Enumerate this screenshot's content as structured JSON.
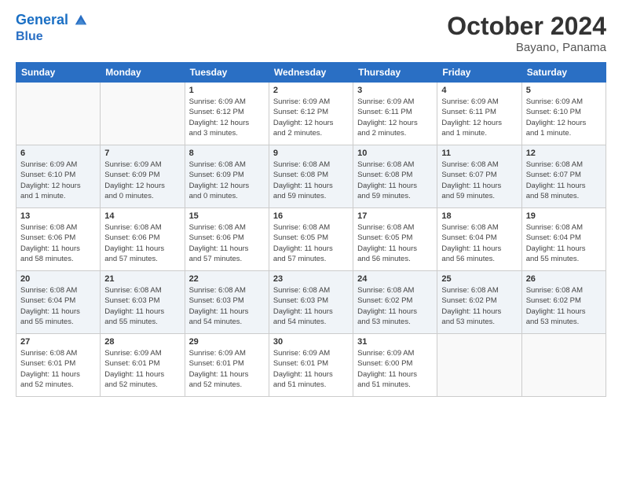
{
  "header": {
    "logo_line1": "General",
    "logo_line2": "Blue",
    "month": "October 2024",
    "location": "Bayano, Panama"
  },
  "weekdays": [
    "Sunday",
    "Monday",
    "Tuesday",
    "Wednesday",
    "Thursday",
    "Friday",
    "Saturday"
  ],
  "weeks": [
    [
      {
        "day": "",
        "detail": ""
      },
      {
        "day": "",
        "detail": ""
      },
      {
        "day": "1",
        "detail": "Sunrise: 6:09 AM\nSunset: 6:12 PM\nDaylight: 12 hours\nand 3 minutes."
      },
      {
        "day": "2",
        "detail": "Sunrise: 6:09 AM\nSunset: 6:12 PM\nDaylight: 12 hours\nand 2 minutes."
      },
      {
        "day": "3",
        "detail": "Sunrise: 6:09 AM\nSunset: 6:11 PM\nDaylight: 12 hours\nand 2 minutes."
      },
      {
        "day": "4",
        "detail": "Sunrise: 6:09 AM\nSunset: 6:11 PM\nDaylight: 12 hours\nand 1 minute."
      },
      {
        "day": "5",
        "detail": "Sunrise: 6:09 AM\nSunset: 6:10 PM\nDaylight: 12 hours\nand 1 minute."
      }
    ],
    [
      {
        "day": "6",
        "detail": "Sunrise: 6:09 AM\nSunset: 6:10 PM\nDaylight: 12 hours\nand 1 minute."
      },
      {
        "day": "7",
        "detail": "Sunrise: 6:09 AM\nSunset: 6:09 PM\nDaylight: 12 hours\nand 0 minutes."
      },
      {
        "day": "8",
        "detail": "Sunrise: 6:08 AM\nSunset: 6:09 PM\nDaylight: 12 hours\nand 0 minutes."
      },
      {
        "day": "9",
        "detail": "Sunrise: 6:08 AM\nSunset: 6:08 PM\nDaylight: 11 hours\nand 59 minutes."
      },
      {
        "day": "10",
        "detail": "Sunrise: 6:08 AM\nSunset: 6:08 PM\nDaylight: 11 hours\nand 59 minutes."
      },
      {
        "day": "11",
        "detail": "Sunrise: 6:08 AM\nSunset: 6:07 PM\nDaylight: 11 hours\nand 59 minutes."
      },
      {
        "day": "12",
        "detail": "Sunrise: 6:08 AM\nSunset: 6:07 PM\nDaylight: 11 hours\nand 58 minutes."
      }
    ],
    [
      {
        "day": "13",
        "detail": "Sunrise: 6:08 AM\nSunset: 6:06 PM\nDaylight: 11 hours\nand 58 minutes."
      },
      {
        "day": "14",
        "detail": "Sunrise: 6:08 AM\nSunset: 6:06 PM\nDaylight: 11 hours\nand 57 minutes."
      },
      {
        "day": "15",
        "detail": "Sunrise: 6:08 AM\nSunset: 6:06 PM\nDaylight: 11 hours\nand 57 minutes."
      },
      {
        "day": "16",
        "detail": "Sunrise: 6:08 AM\nSunset: 6:05 PM\nDaylight: 11 hours\nand 57 minutes."
      },
      {
        "day": "17",
        "detail": "Sunrise: 6:08 AM\nSunset: 6:05 PM\nDaylight: 11 hours\nand 56 minutes."
      },
      {
        "day": "18",
        "detail": "Sunrise: 6:08 AM\nSunset: 6:04 PM\nDaylight: 11 hours\nand 56 minutes."
      },
      {
        "day": "19",
        "detail": "Sunrise: 6:08 AM\nSunset: 6:04 PM\nDaylight: 11 hours\nand 55 minutes."
      }
    ],
    [
      {
        "day": "20",
        "detail": "Sunrise: 6:08 AM\nSunset: 6:04 PM\nDaylight: 11 hours\nand 55 minutes."
      },
      {
        "day": "21",
        "detail": "Sunrise: 6:08 AM\nSunset: 6:03 PM\nDaylight: 11 hours\nand 55 minutes."
      },
      {
        "day": "22",
        "detail": "Sunrise: 6:08 AM\nSunset: 6:03 PM\nDaylight: 11 hours\nand 54 minutes."
      },
      {
        "day": "23",
        "detail": "Sunrise: 6:08 AM\nSunset: 6:03 PM\nDaylight: 11 hours\nand 54 minutes."
      },
      {
        "day": "24",
        "detail": "Sunrise: 6:08 AM\nSunset: 6:02 PM\nDaylight: 11 hours\nand 53 minutes."
      },
      {
        "day": "25",
        "detail": "Sunrise: 6:08 AM\nSunset: 6:02 PM\nDaylight: 11 hours\nand 53 minutes."
      },
      {
        "day": "26",
        "detail": "Sunrise: 6:08 AM\nSunset: 6:02 PM\nDaylight: 11 hours\nand 53 minutes."
      }
    ],
    [
      {
        "day": "27",
        "detail": "Sunrise: 6:08 AM\nSunset: 6:01 PM\nDaylight: 11 hours\nand 52 minutes."
      },
      {
        "day": "28",
        "detail": "Sunrise: 6:09 AM\nSunset: 6:01 PM\nDaylight: 11 hours\nand 52 minutes."
      },
      {
        "day": "29",
        "detail": "Sunrise: 6:09 AM\nSunset: 6:01 PM\nDaylight: 11 hours\nand 52 minutes."
      },
      {
        "day": "30",
        "detail": "Sunrise: 6:09 AM\nSunset: 6:01 PM\nDaylight: 11 hours\nand 51 minutes."
      },
      {
        "day": "31",
        "detail": "Sunrise: 6:09 AM\nSunset: 6:00 PM\nDaylight: 11 hours\nand 51 minutes."
      },
      {
        "day": "",
        "detail": ""
      },
      {
        "day": "",
        "detail": ""
      }
    ]
  ]
}
